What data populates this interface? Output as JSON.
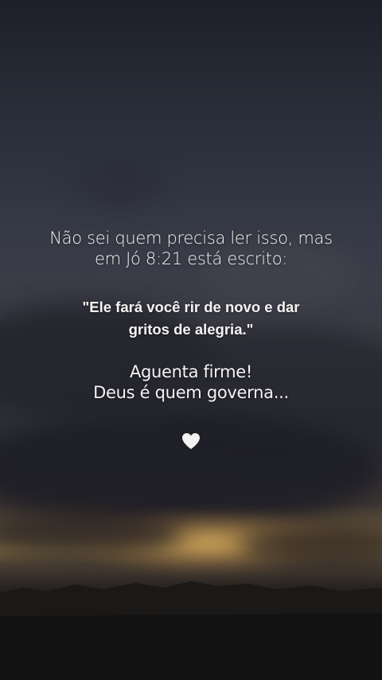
{
  "background": {
    "description_colors": {
      "sky_top": "#1d2029",
      "clouds": "#2a2a32",
      "sunset_glow": "#8a7445",
      "ground": "#141313"
    }
  },
  "message": {
    "intro_line_1": "Não sei quem precisa ler isso, mas",
    "intro_line_2": "em Jó 8:21 está escrito:",
    "verse_line_1": "\"Ele fará você rir de novo e dar",
    "verse_line_2": "gritos de alegria.\"",
    "closing_line_1": "Aguenta firme!",
    "closing_line_2": "Deus é quem governa..."
  },
  "icons": {
    "heart": "white-heart-icon",
    "heart_color": "#f2f2f2"
  }
}
